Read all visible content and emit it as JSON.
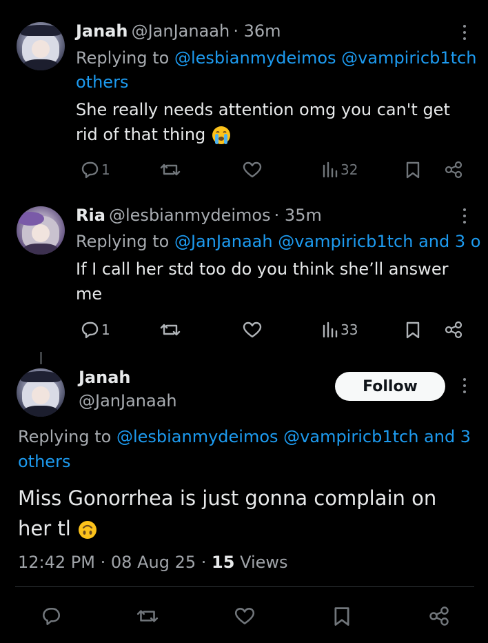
{
  "tweets": [
    {
      "display_name": "Janah",
      "handle": "@JanJanaah",
      "time": "· 36m",
      "replying_prefix": "Replying to",
      "replying_mentions": "@lesbianmydeimos @vampiricb1tch",
      "replying_suffix": "others",
      "body_line1": "She really needs attention omg you can't get",
      "body_line2": "rid of that thing",
      "body_emoji": "loudly-crying-face-emoji",
      "reply_count": "1",
      "view_count": "32"
    },
    {
      "display_name": "Ria",
      "handle": "@lesbianmydeimos",
      "time": "· 35m",
      "replying_prefix": "Replying to",
      "replying_mentions": "@JanJanaah @vampiricb1tch and 3 o",
      "body_line1": "If I call her std too do you think she’ll answer",
      "body_line2": "me",
      "reply_count": "1",
      "view_count": "33"
    }
  ],
  "main_tweet": {
    "display_name": "Janah",
    "handle": "@JanJanaah",
    "follow_label": "Follow",
    "replying_prefix": "Replying to",
    "replying_mentions": "@lesbianmydeimos @vampiricb1tch and 3",
    "replying_suffix": "others",
    "body_line1": "Miss Gonorrhea is just gonna complain on",
    "body_line2": "her tl",
    "body_emoji": "upside-down-face-emoji",
    "time": "12:42 PM",
    "date": "08 Aug 25",
    "views_count": "15",
    "views_label": "Views"
  },
  "colors": {
    "background": "#000000",
    "text": "#e7e9ea",
    "muted": "#a7abb0",
    "link": "#1d9bf0",
    "icon": "#71767b",
    "follow_bg": "#f7f9f9"
  }
}
